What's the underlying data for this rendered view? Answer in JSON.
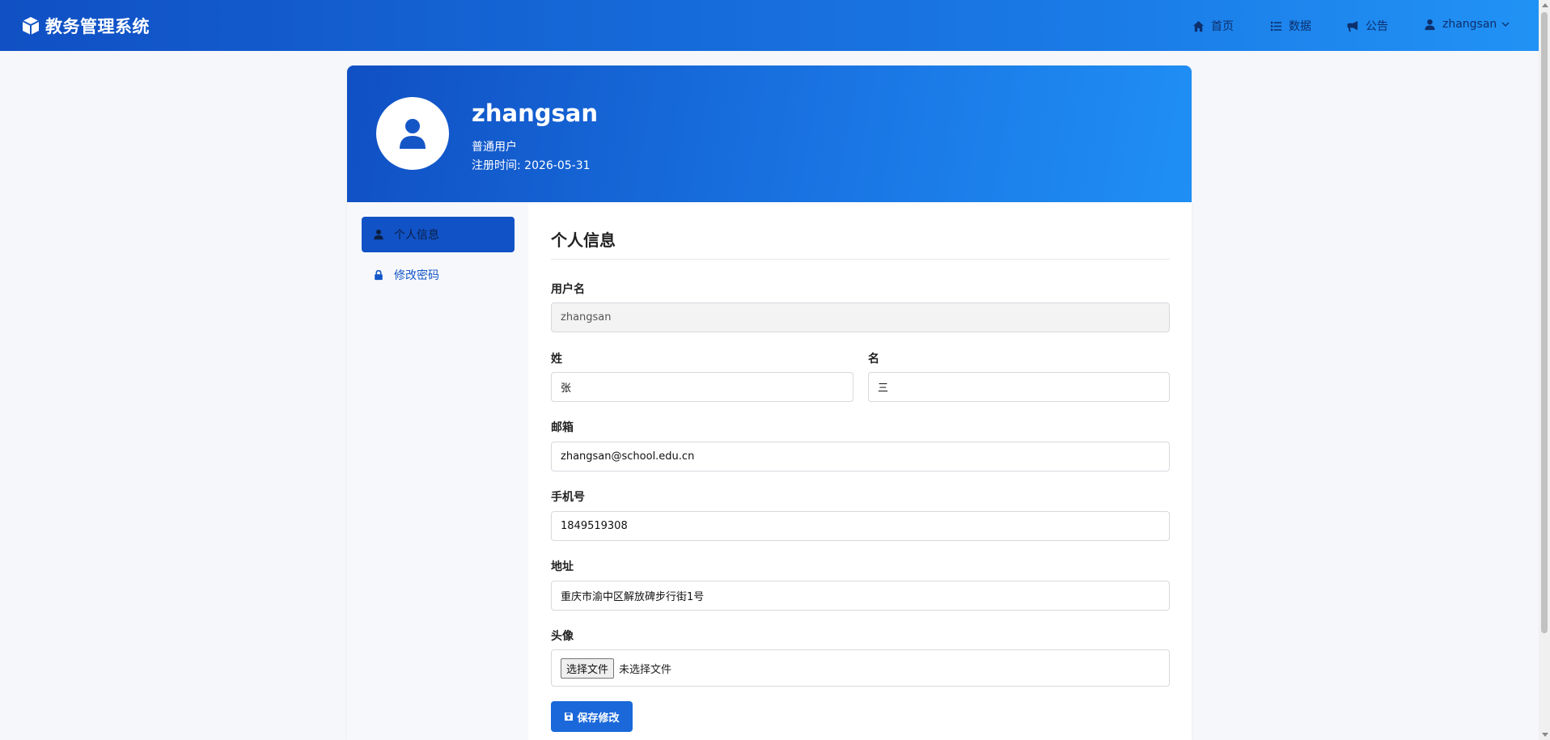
{
  "app": {
    "title": "教务管理系统"
  },
  "nav": {
    "home": "首页",
    "data": "数据",
    "notice": "公告",
    "user": "zhangsan"
  },
  "profile": {
    "name": "zhangsan",
    "role": "普通用户",
    "registered_label": "注册时间:",
    "registered_date": "2026-05-31"
  },
  "sidebar": {
    "items": [
      {
        "label": "个人信息",
        "icon": "user-icon",
        "active": true
      },
      {
        "label": "修改密码",
        "icon": "lock-icon",
        "active": false
      }
    ]
  },
  "form": {
    "title": "个人信息",
    "username_label": "用户名",
    "username_value": "zhangsan",
    "last_name_label": "姓",
    "last_name_value": "张",
    "first_name_label": "名",
    "first_name_value": "三",
    "email_label": "邮箱",
    "email_value": "zhangsan@school.edu.cn",
    "phone_label": "手机号",
    "phone_value": "1849519308",
    "address_label": "地址",
    "address_value": "重庆市渝中区解放碑步行街1号",
    "avatar_label": "头像",
    "file_button": "选择文件",
    "file_status": "未选择文件",
    "save_label": "保存修改"
  },
  "colors": {
    "primary": "#1152c6",
    "header_gradient_start": "#1050c4",
    "header_gradient_end": "#2192f5",
    "background": "#f5f7fb"
  }
}
